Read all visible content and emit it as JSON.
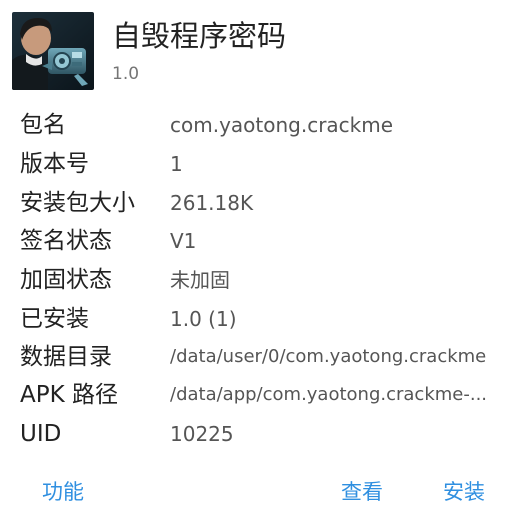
{
  "app": {
    "name": "自毁程序密码",
    "version": "1.0",
    "icon": "app-icon"
  },
  "details": [
    {
      "label": "包名",
      "value": "com.yaotong.crackme"
    },
    {
      "label": "版本号",
      "value": "1"
    },
    {
      "label": "安装包大小",
      "value": "261.18K"
    },
    {
      "label": "签名状态",
      "value": "V1"
    },
    {
      "label": "加固状态",
      "value": "未加固"
    },
    {
      "label": "已安装",
      "value": "1.0 (1)"
    },
    {
      "label": "数据目录",
      "value": "/data/user/0/com.yaotong.crackme"
    },
    {
      "label": "APK 路径",
      "value": "/data/app/com.yaotong.crackme-..."
    },
    {
      "label": "UID",
      "value": "10225"
    }
  ],
  "actions": {
    "features": "功能",
    "view": "查看",
    "install": "安装"
  },
  "colors": {
    "accent": "#2f8fe0",
    "text": "#222222",
    "secondary": "#555555"
  }
}
